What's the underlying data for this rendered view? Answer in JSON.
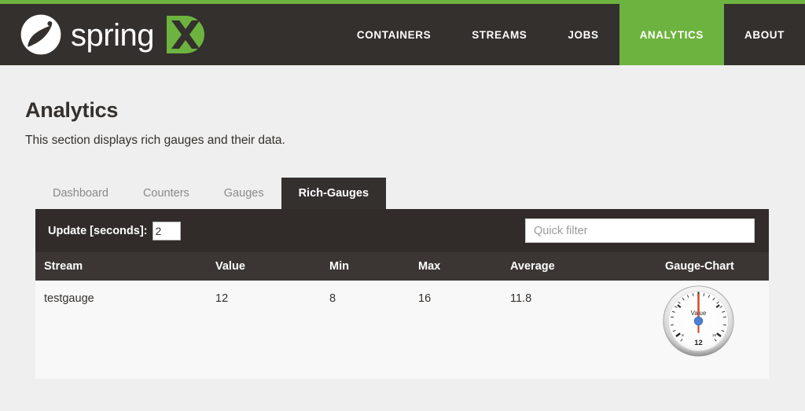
{
  "theme": {
    "accent_green": "#6db33f",
    "dark": "#34302d",
    "toolbar_dark": "#312c29",
    "header_row": "#3b3633",
    "page_bg": "#efefef",
    "panel_bg": "#f8f8f8",
    "needle_red": "#d4482a",
    "hub_blue": "#4a7fd4"
  },
  "header": {
    "brand_word": "spring",
    "brand_badge": "XD",
    "logo_icon": "spring-leaf-icon",
    "nav": [
      {
        "label": "CONTAINERS",
        "active": false
      },
      {
        "label": "STREAMS",
        "active": false
      },
      {
        "label": "JOBS",
        "active": false
      },
      {
        "label": "ANALYTICS",
        "active": true
      },
      {
        "label": "ABOUT",
        "active": false
      }
    ]
  },
  "page": {
    "title": "Analytics",
    "description": "This section displays rich gauges and their data."
  },
  "tabs": [
    {
      "label": "Dashboard",
      "active": false
    },
    {
      "label": "Counters",
      "active": false
    },
    {
      "label": "Gauges",
      "active": false
    },
    {
      "label": "Rich-Gauges",
      "active": true
    }
  ],
  "toolbar": {
    "update_label": "Update [seconds]:",
    "update_value": "2",
    "filter_placeholder": "Quick filter",
    "filter_value": ""
  },
  "table": {
    "columns": [
      "Stream",
      "Value",
      "Min",
      "Max",
      "Average",
      "Gauge-Chart"
    ],
    "rows": [
      {
        "stream": "testgauge",
        "value": "12",
        "min": "8",
        "max": "16",
        "average": "11.8"
      }
    ]
  },
  "chart_data": {
    "type": "gauge",
    "title": "Value",
    "value": 12,
    "min": 8,
    "max": 16,
    "value_label": "12",
    "min_label": "8",
    "max_label": "16",
    "needle_color": "#d4482a",
    "hub_color": "#4a7fd4",
    "face_color": "#fdfdfd",
    "rim_color": "#c9c9c9"
  }
}
